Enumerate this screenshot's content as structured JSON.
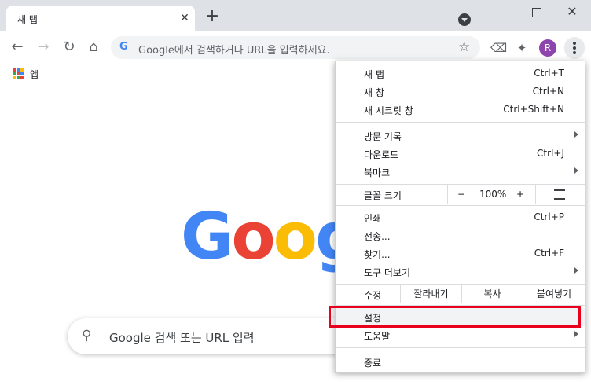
{
  "tab": {
    "title": "새 탭",
    "close": "✕",
    "new_tab": "+"
  },
  "window": {
    "close": "✕"
  },
  "toolbar": {
    "back": "←",
    "forward": "→",
    "reload": "↻",
    "home": "⌂",
    "omnibox_placeholder": "Google에서 검색하거나 URL을 입력하세요.",
    "g_letter": "G",
    "star": "☆",
    "avatar_letter": "R",
    "icons": [
      "back-icon",
      "forward-icon",
      "reload-icon",
      "home-icon",
      "star-icon",
      "extension-icon",
      "puzzle-icon",
      "kebab-menu-icon"
    ]
  },
  "bookmarks": {
    "apps_label": "앱"
  },
  "page": {
    "logo_letters": [
      "G",
      "o",
      "o",
      "g"
    ],
    "logo_colors": [
      "#4285F4",
      "#EA4335",
      "#FBBC05",
      "#4285F4"
    ],
    "search_placeholder": "Google 검색 또는 URL 입력"
  },
  "menu": {
    "new_tab": "새 탭",
    "new_tab_sc": "Ctrl+T",
    "new_window": "새 창",
    "new_window_sc": "Ctrl+N",
    "incognito": "새 시크릿 창",
    "incognito_sc": "Ctrl+Shift+N",
    "history": "방문 기록",
    "downloads": "다운로드",
    "downloads_sc": "Ctrl+J",
    "bookmarks": "북마크",
    "zoom": "글꼴 크기",
    "zoom_minus": "−",
    "zoom_value": "100%",
    "zoom_plus": "+",
    "print": "인쇄",
    "print_sc": "Ctrl+P",
    "cast": "전송...",
    "find": "찾기...",
    "find_sc": "Ctrl+F",
    "more_tools": "도구 더보기",
    "edit": "수정",
    "cut": "잘라내기",
    "copy": "복사",
    "paste": "붙여넣기",
    "settings": "설정",
    "help": "도움말",
    "exit": "종료"
  },
  "colors": {
    "highlight": "#e8001c",
    "accent": "#4285F4"
  }
}
